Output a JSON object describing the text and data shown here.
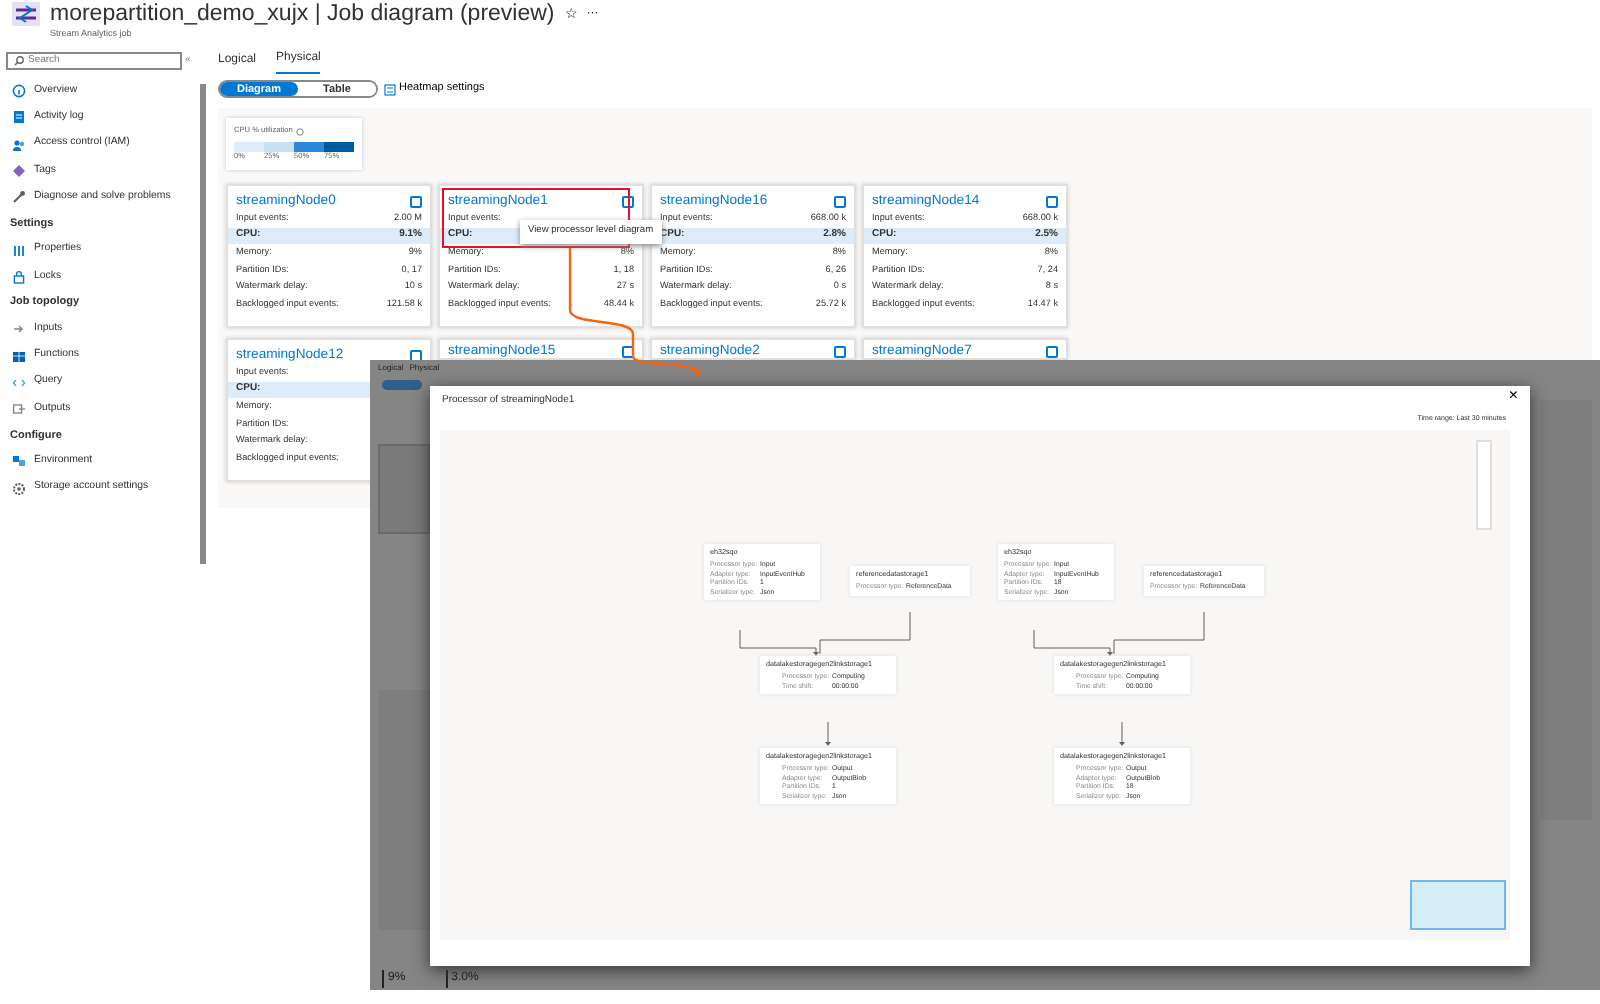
{
  "header": {
    "title": "morepartition_demo_xujx | Job diagram (preview)",
    "subtitle": "Stream Analytics job",
    "star": "☆",
    "more": "···"
  },
  "sidebar": {
    "search_placeholder": "Search",
    "collapse": "«",
    "sections": [
      {
        "items": [
          {
            "label": "Overview"
          },
          {
            "label": "Activity log"
          },
          {
            "label": "Access control (IAM)"
          },
          {
            "label": "Tags"
          },
          {
            "label": "Diagnose and solve problems"
          }
        ]
      },
      {
        "heading": "Settings",
        "items": [
          {
            "label": "Properties"
          },
          {
            "label": "Locks"
          }
        ]
      },
      {
        "heading": "Job topology",
        "items": [
          {
            "label": "Inputs"
          },
          {
            "label": "Functions"
          },
          {
            "label": "Query"
          },
          {
            "label": "Outputs"
          }
        ]
      },
      {
        "heading": "Configure",
        "items": [
          {
            "label": "Environment"
          },
          {
            "label": "Storage account settings"
          }
        ]
      }
    ]
  },
  "tabs": [
    {
      "label": "Logical",
      "selected": false
    },
    {
      "label": "Physical",
      "selected": true
    }
  ],
  "view_toggle": [
    {
      "label": "Diagram",
      "selected": true
    },
    {
      "label": "Table",
      "selected": false
    }
  ],
  "heatmap_settings": "Heatmap settings",
  "legend": {
    "title": "CPU % utilization",
    "segments": [
      {
        "label": "0%",
        "color": "#deecf9"
      },
      {
        "label": "25%",
        "color": "#c7e0f4"
      },
      {
        "label": "50%",
        "color": "#2b88d8"
      },
      {
        "label": "75%",
        "color": "#005a9e"
      }
    ]
  },
  "nodes": [
    {
      "name": "streamingNode0",
      "checked": false,
      "outlined": false,
      "metrics": [
        {
          "label": "Input events:",
          "value": "2.00 M"
        },
        {
          "label": "CPU:",
          "value": "9.1%",
          "kind": "highlight"
        },
        {
          "label": "Memory:",
          "value": "9%"
        },
        {
          "label": "Partition IDs:",
          "value": "0, 17"
        },
        {
          "label": "Watermark delay:",
          "value": "10 s"
        },
        {
          "label": "Backlogged input events:",
          "value": "121.58 k"
        }
      ]
    },
    {
      "name": "streamingNode1",
      "checked": false,
      "outlined": true,
      "tooltip": "View processor level diagram",
      "metrics": [
        {
          "label": "Input events:"
        },
        {
          "label": "CPU:",
          "kind": "highlight"
        },
        {
          "label": "Memory:",
          "value": "8%"
        },
        {
          "label": "Partition IDs:",
          "value": "1, 18"
        },
        {
          "label": "Watermark delay:",
          "value": "27 s"
        },
        {
          "label": "Backlogged input events:",
          "value": "48.44 k"
        }
      ]
    },
    {
      "name": "streamingNode16",
      "checked": false,
      "outlined": false,
      "metrics": [
        {
          "label": "Input events:",
          "value": "668.00 k"
        },
        {
          "label": "CPU:",
          "value": "2.8%",
          "kind": "highlight"
        },
        {
          "label": "Memory:",
          "value": "8%"
        },
        {
          "label": "Partition IDs:",
          "value": "6, 26"
        },
        {
          "label": "Watermark delay:",
          "value": "0 s"
        },
        {
          "label": "Backlogged input events:",
          "value": "25.72 k"
        }
      ]
    },
    {
      "name": "streamingNode14",
      "checked": false,
      "outlined": false,
      "metrics": [
        {
          "label": "Input events:",
          "value": "668.00 k"
        },
        {
          "label": "CPU:",
          "value": "2.5%",
          "kind": "highlight"
        },
        {
          "label": "Memory:",
          "value": "8%"
        },
        {
          "label": "Partition IDs:",
          "value": "7, 24"
        },
        {
          "label": "Watermark delay:",
          "value": "8 s"
        },
        {
          "label": "Backlogged input events:",
          "value": "14.47 k"
        }
      ]
    },
    {
      "name": "streamingNode12",
      "checked": false,
      "outlined": false,
      "metrics": [
        {
          "label": "Input events:"
        },
        {
          "label": "CPU:",
          "kind": "highlight"
        },
        {
          "label": "Memory:"
        },
        {
          "label": "Partition IDs:"
        },
        {
          "label": "Watermark delay:"
        },
        {
          "label": "Backlogged input events:"
        }
      ]
    },
    {
      "name": "streamingNode15",
      "checked": false,
      "outlined": false
    },
    {
      "name": "streamingNode2",
      "checked": false,
      "outlined": false
    },
    {
      "name": "streamingNode7",
      "checked": false,
      "outlined": false
    }
  ],
  "background_screen": {
    "tabs": [
      "Logical",
      "Physical"
    ],
    "readings": [
      "9%",
      "3.0%"
    ]
  },
  "dialog": {
    "title": "Processor of streamingNode1",
    "close": "×",
    "time_range": "Time range: Last 30 minutes",
    "graphs": [
      {
        "nodes": [
          {
            "kind": "input",
            "name": "eh32sqo",
            "props": [
              {
                "label": "Processor type:",
                "value": "Input"
              },
              {
                "label": "Adapter type:",
                "value": "InputEventHub"
              },
              {
                "label": "Partition IDs:",
                "value": "1"
              },
              {
                "label": "Serializer type:",
                "value": "Json"
              }
            ]
          },
          {
            "kind": "reference",
            "name": "referencedatastorage1",
            "props": [
              {
                "label": "Processor type:",
                "value": "ReferenceData"
              }
            ]
          },
          {
            "kind": "computing",
            "name": "datalakestoragegen2linkstorage1",
            "props": [
              {
                "label": "Processor type:",
                "value": "Computing"
              },
              {
                "label": "Time shift:",
                "value": "00:00:00"
              }
            ]
          },
          {
            "kind": "output",
            "name": "datalakestoragegen2linkstorage1",
            "props": [
              {
                "label": "Processor type:",
                "value": "Output"
              },
              {
                "label": "Adapter type:",
                "value": "OutputBlob"
              },
              {
                "label": "Partition IDs:",
                "value": "1"
              },
              {
                "label": "Serializer type:",
                "value": "Json"
              }
            ]
          }
        ]
      },
      {
        "nodes": [
          {
            "kind": "input",
            "name": "eh32sqo",
            "props": [
              {
                "label": "Processor type:",
                "value": "Input"
              },
              {
                "label": "Adapter type:",
                "value": "InputEventHub"
              },
              {
                "label": "Partition IDs:",
                "value": "18"
              },
              {
                "label": "Serializer type:",
                "value": "Json"
              }
            ]
          },
          {
            "kind": "reference",
            "name": "referencedatastorage1",
            "props": [
              {
                "label": "Processor type:",
                "value": "ReferenceData"
              }
            ]
          },
          {
            "kind": "computing",
            "name": "datalakestoragegen2linkstorage1",
            "props": [
              {
                "label": "Processor type:",
                "value": "Computing"
              },
              {
                "label": "Time shift:",
                "value": "00:00:00"
              }
            ]
          },
          {
            "kind": "output",
            "name": "datalakestoragegen2linkstorage1",
            "props": [
              {
                "label": "Processor type:",
                "value": "Output"
              },
              {
                "label": "Adapter type:",
                "value": "OutputBlob"
              },
              {
                "label": "Partition IDs:",
                "value": "18"
              },
              {
                "label": "Serializer type:",
                "value": "Json"
              }
            ]
          }
        ]
      }
    ]
  }
}
